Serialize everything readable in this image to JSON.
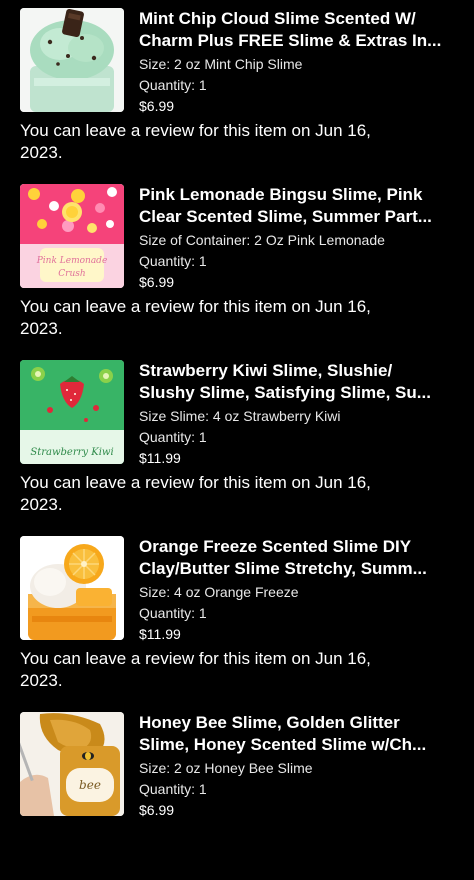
{
  "orders": [
    {
      "title_line1": "Mint Chip Cloud Slime Scented W/",
      "title_line2": "Charm Plus FREE Slime & Extras In...",
      "variant": "Size: 2 oz Mint Chip Slime",
      "quantity": "Quantity: 1",
      "price": "$6.99",
      "review_line1": "You can leave a review for this item on Jun 16,",
      "review_line2": "2023.",
      "image_icon": "mint-chip-slime-photo"
    },
    {
      "title_line1": "Pink Lemonade Bingsu Slime, Pink",
      "title_line2": "Clear Scented Slime, Summer Part...",
      "variant": "Size of Container: 2 Oz Pink Lemonade",
      "quantity": "Quantity: 1",
      "price": "$6.99",
      "review_line1": "You can leave a review for this item on Jun 16,",
      "review_line2": "2023.",
      "image_icon": "pink-lemonade-slime-photo"
    },
    {
      "title_line1": "Strawberry Kiwi Slime, Slushie/",
      "title_line2": "Slushy Slime, Satisfying Slime, Su...",
      "variant": "Size Slime: 4 oz Strawberry Kiwi",
      "quantity": "Quantity: 1",
      "price": "$11.99",
      "review_line1": "You can leave a review for this item on Jun 16,",
      "review_line2": "2023.",
      "image_icon": "strawberry-kiwi-slime-photo"
    },
    {
      "title_line1": "Orange Freeze Scented Slime DIY",
      "title_line2": "Clay/Butter Slime Stretchy, Summ...",
      "variant": "Size: 4 oz Orange Freeze",
      "quantity": "Quantity: 1",
      "price": "$11.99",
      "review_line1": "You can leave a review for this item on Jun 16,",
      "review_line2": "2023.",
      "image_icon": "orange-freeze-slime-photo"
    },
    {
      "title_line1": "Honey Bee Slime, Golden Glitter",
      "title_line2": "Slime, Honey Scented Slime w/Ch...",
      "variant": "Size: 2 oz Honey Bee Slime",
      "quantity": "Quantity: 1",
      "price": "$6.99",
      "review_line1": "",
      "review_line2": "",
      "image_icon": "honey-bee-slime-photo"
    }
  ],
  "thumbnail_texts": {
    "item2": "Pink Lemonade Crush",
    "item3": "Strawberry Kiwi",
    "item5": "bee"
  }
}
